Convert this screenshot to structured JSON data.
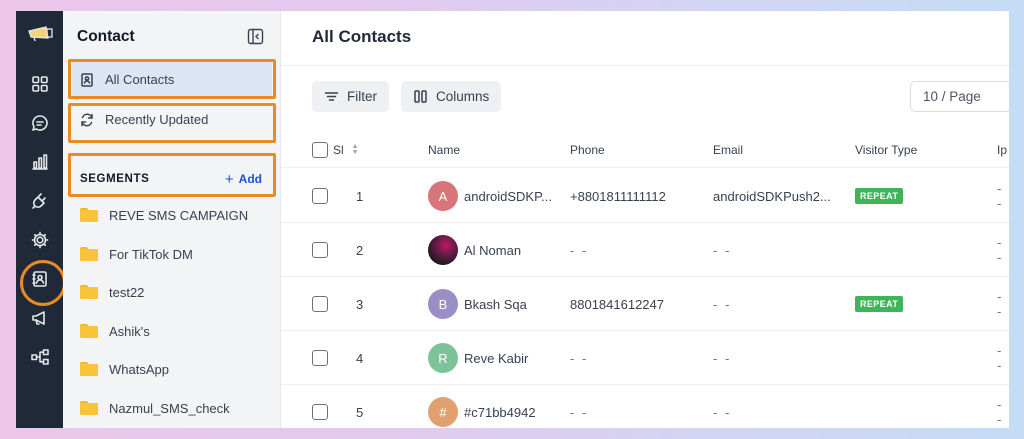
{
  "colors": {
    "accent_highlight": "#ea8a24",
    "rail_bg": "#1f2937",
    "badge_green": "#3fb55a",
    "link_blue": "#1d4ed8"
  },
  "rail": {
    "logo": "megaphone-logo-icon",
    "items": [
      {
        "icon": "dashboard-grid-icon"
      },
      {
        "icon": "chat-bubble-icon"
      },
      {
        "icon": "bar-chart-icon"
      },
      {
        "icon": "plug-icon"
      },
      {
        "icon": "gear-icon"
      },
      {
        "icon": "contact-card-icon",
        "active": true
      },
      {
        "icon": "megaphone-icon"
      },
      {
        "icon": "flow-diagram-icon"
      }
    ]
  },
  "panel": {
    "title": "Contact",
    "nav": {
      "all_contacts": "All Contacts",
      "recently_updated": "Recently Updated"
    },
    "segments": {
      "title": "SEGMENTS",
      "add_label": "Add",
      "folders": [
        "REVE SMS CAMPAIGN",
        "For TikTok DM",
        "test22",
        "Ashik's",
        "WhatsApp",
        "Nazmul_SMS_check"
      ]
    }
  },
  "main": {
    "title": "All Contacts",
    "toolbar": {
      "filter": "Filter",
      "columns": "Columns",
      "page_size": "10 / Page"
    },
    "columns": {
      "sl": "Sl",
      "name": "Name",
      "phone": "Phone",
      "email": "Email",
      "visitor_type": "Visitor Type",
      "ip": "Ip"
    },
    "rows": [
      {
        "sl": "1",
        "initial": "A",
        "avatar_color": "#d9757a",
        "name": "androidSDKP...",
        "phone": "+8801811111112",
        "email": "androidSDKPush2...",
        "visitor_type": "REPEAT",
        "ip": "- -"
      },
      {
        "sl": "2",
        "initial": "",
        "avatar_color": "",
        "name": "Al Noman",
        "phone": "- -",
        "email": "- -",
        "visitor_type": "",
        "ip": "- -"
      },
      {
        "sl": "3",
        "initial": "B",
        "avatar_color": "#9a8ec7",
        "name": "Bkash Sqa",
        "phone": "8801841612247",
        "email": "- -",
        "visitor_type": "REPEAT",
        "ip": "- -"
      },
      {
        "sl": "4",
        "initial": "R",
        "avatar_color": "#7cc39a",
        "name": "Reve Kabir",
        "phone": "- -",
        "email": "- -",
        "visitor_type": "",
        "ip": "- -"
      },
      {
        "sl": "5",
        "initial": "#",
        "avatar_color": "#e0a070",
        "name": "#c71bb4942",
        "phone": "- -",
        "email": "- -",
        "visitor_type": "",
        "ip": "- -"
      }
    ]
  }
}
